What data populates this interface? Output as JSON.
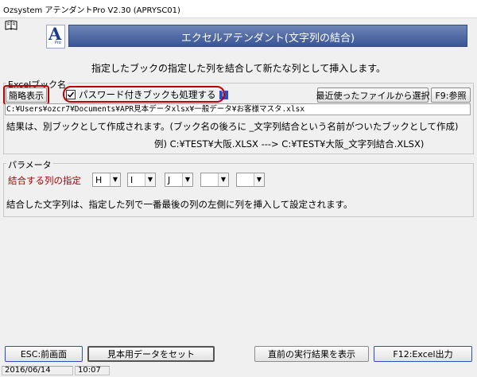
{
  "window": {
    "title": "Ozsystem アテンダントPro V2.30 (APRYSC01)"
  },
  "banner": {
    "title": "エクセルアテンダント(文字列の結合)",
    "logo_letter": "A",
    "logo_sub": "Pro"
  },
  "description": "指定したブックの指定した列を結合して新たな列として挿入します。",
  "excel_book": {
    "group_label": "Excelブック名",
    "simple_view_button": "簡略表示",
    "password_checkbox_label": "パスワード付きブックも処理する",
    "password_checked": true,
    "help_badge": "?",
    "recent_files_button": "最近使ったファイルから選択",
    "browse_button": "F9:参照",
    "path": "C:¥Users¥ozcr7¥Documents¥APR見本データxlsx¥一般データ¥お客様マスタ.xlsx",
    "note_line1": "結果は、別ブックとして作成されます。(ブック名の後ろに _文字列結合という名前がついたブックとして作成)",
    "note_line2": "例) C:¥TEST¥大阪.XLSX ---> C:¥TEST¥大阪_文字列結合.XLSX)"
  },
  "parameters": {
    "group_label": "パラメータ",
    "columns_label": "結合する列の指定",
    "columns": [
      "H",
      "I",
      "J",
      "",
      ""
    ],
    "note": "結合した文字列は、指定した列で一番最後の列の左側に列を挿入して設定されます。"
  },
  "footer": {
    "esc_button": "ESC:前画面",
    "sample_button": "見本用データをセット",
    "last_result_button": "直前の実行結果を表示",
    "excel_output_button": "F12:Excel出力"
  },
  "status": {
    "date": "2016/06/14",
    "time": "10:07"
  }
}
